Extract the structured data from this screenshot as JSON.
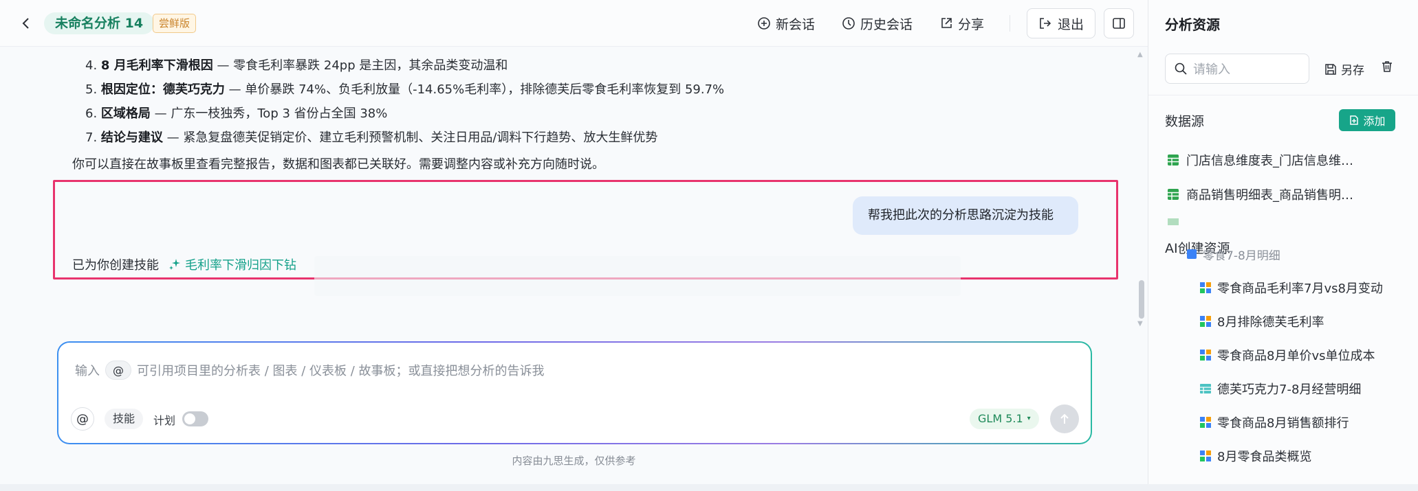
{
  "header": {
    "title": "未命名分析 14",
    "trial_badge": "尝鲜版",
    "new_chat": "新会话",
    "history": "历史会话",
    "share": "分享",
    "logout": "退出"
  },
  "chat": {
    "summary_items": [
      {
        "num": "4.",
        "bold": "8 月毛利率下滑根因",
        "rest": " — 零食毛利率暴跌 24pp 是主因，其余品类变动温和"
      },
      {
        "num": "5.",
        "bold": "根因定位：德芙巧克力",
        "rest": " — 单价暴跌 74%、负毛利放量（-14.65%毛利率），排除德芙后零食毛利率恢复到 59.7%"
      },
      {
        "num": "6.",
        "bold": "区域格局",
        "rest": " — 广东一枝独秀，Top 3 省份占全国 38%"
      },
      {
        "num": "7.",
        "bold": "结论与建议",
        "rest": " — 紧急复盘德芙促销定价、建立毛利预警机制、关注日用品/调料下行趋势、放大生鲜优势"
      }
    ],
    "closing": "你可以直接在故事板里查看完整报告，数据和图表都已关联好。需要调整内容或补充方向随时说。",
    "user_message": "帮我把此次的分析思路沉淀为技能",
    "bot_reply_prefix": "已为你创建技能",
    "skill_name": "毛利率下滑归因下钻"
  },
  "input": {
    "placeholder_prefix": "输入",
    "at_symbol": "@",
    "placeholder_suffix": "可引用项目里的分析表 / 图表 / 仪表板 / 故事板；或直接把想分析的告诉我",
    "skill_label": "技能",
    "plan_label": "计划",
    "plan_enabled": false,
    "model": "GLM 5.1",
    "model_caret": "▾"
  },
  "footnote": "内容由九思生成，仅供参考",
  "sidebar": {
    "title": "分析资源",
    "search_placeholder": "请输入",
    "save_as": "另存",
    "datasource_title": "数据源",
    "add_label": "添加",
    "datasources": [
      {
        "name": "门店信息维度表_门店信息维…",
        "icon": "table-icon"
      },
      {
        "name": "商品销售明细表_商品销售明…",
        "icon": "table-icon"
      }
    ],
    "ai_title": "AI创建资源",
    "ai_folder": "零食7-8月明细",
    "ai_items": [
      {
        "name": "零食商品毛利率7月vs8月变动",
        "icon": "chart-icon"
      },
      {
        "name": "8月排除德芙毛利率",
        "icon": "chart-icon"
      },
      {
        "name": "零食商品8月单价vs单位成本",
        "icon": "chart-icon"
      },
      {
        "name": "德芙巧克力7-8月经营明细",
        "icon": "table-view-icon"
      },
      {
        "name": "零食商品8月销售额排行",
        "icon": "chart-icon"
      },
      {
        "name": "8月零食品类概览",
        "icon": "chart-icon"
      }
    ]
  },
  "colors": {
    "accent": "#17a589",
    "highlight_border": "#e8336d",
    "user_bubble": "#dfeafb"
  }
}
